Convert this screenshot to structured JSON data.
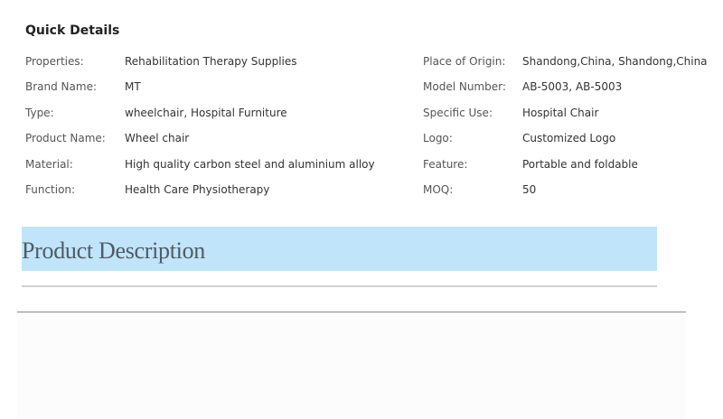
{
  "quick_details": {
    "title": "Quick Details",
    "rows": [
      {
        "label_left": "Properties:",
        "value_left": "Rehabilitation Therapy Supplies",
        "label_right": "Place of Origin:",
        "value_right": "Shandong,China, Shandong,China"
      },
      {
        "label_left": "Brand Name:",
        "value_left": "MT",
        "label_right": "Model Number:",
        "value_right": "AB-5003, AB-5003"
      },
      {
        "label_left": "Type:",
        "value_left": "wheelchair, Hospital Furniture",
        "label_right": "Specific Use:",
        "value_right": "Hospital Chair"
      },
      {
        "label_left": "Product Name:",
        "value_left": "Wheel chair",
        "label_right": "Logo:",
        "value_right": "Customized Logo"
      },
      {
        "label_left": "Material:",
        "value_left": "High quality carbon steel and aluminium alloy",
        "label_right": "Feature:",
        "value_right": "Portable and foldable"
      },
      {
        "label_left": "Function:",
        "value_left": "Health Care Physiotherapy",
        "label_right": "MOQ:",
        "value_right": "50"
      }
    ]
  },
  "product_description": {
    "title": "Product Description",
    "bar_color": "#c0e4fa"
  }
}
